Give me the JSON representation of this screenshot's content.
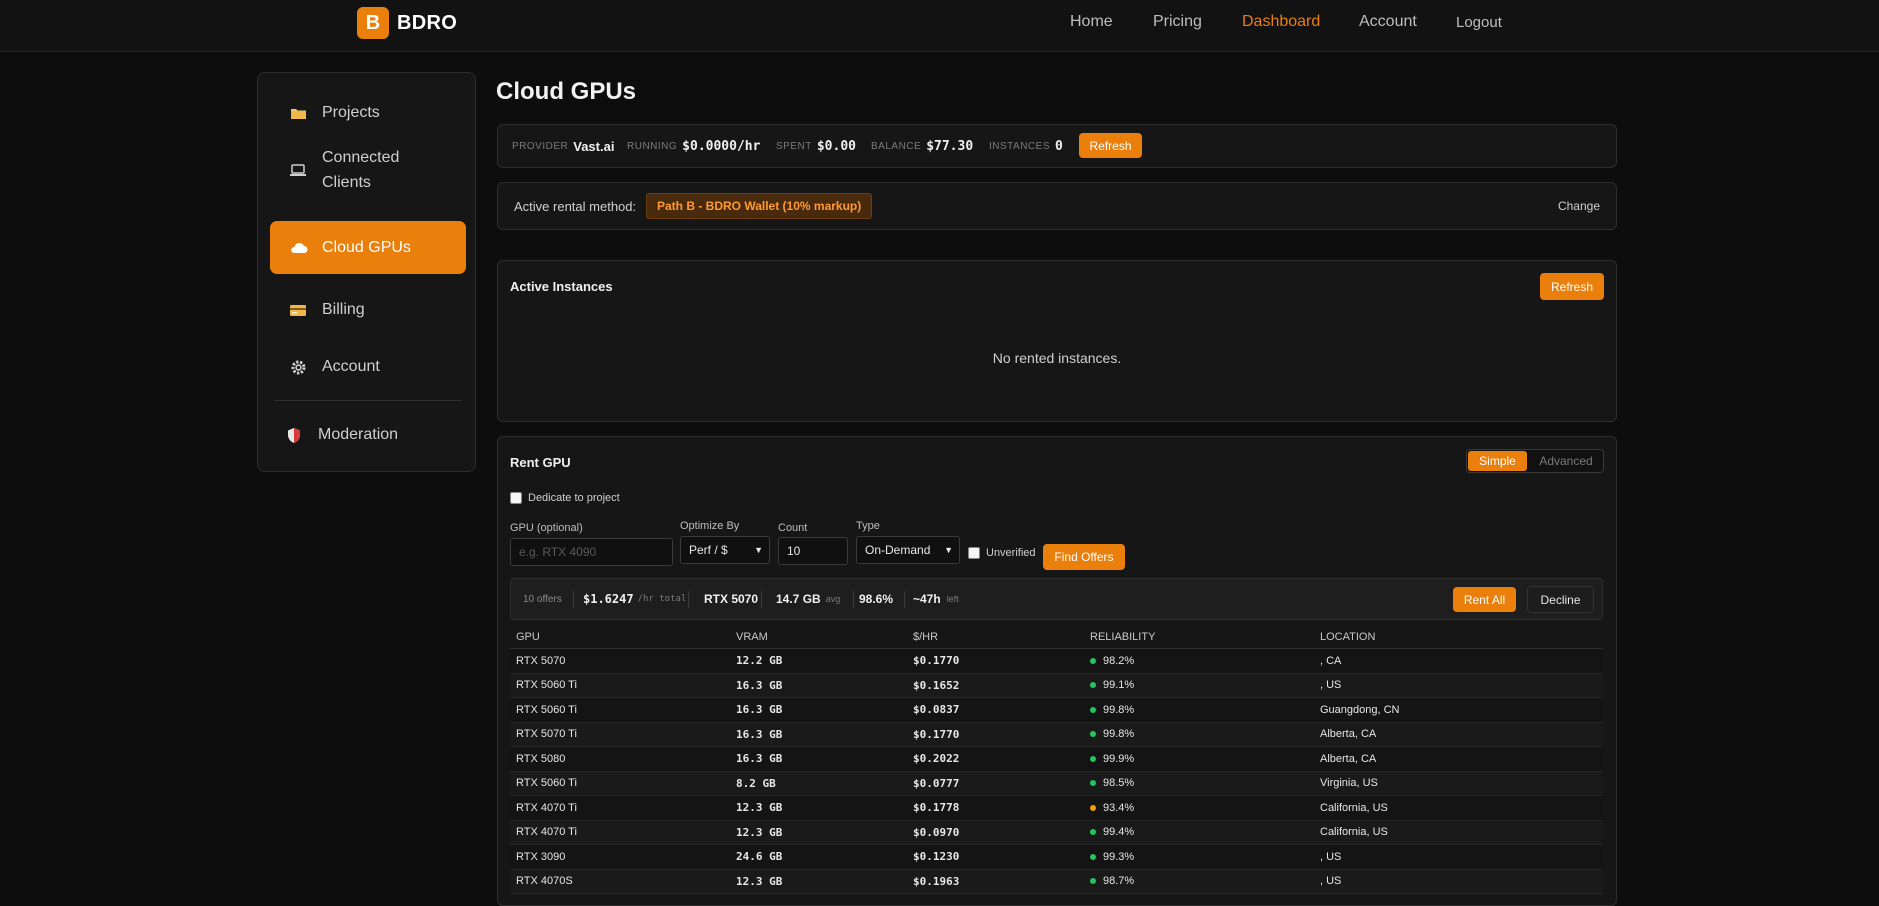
{
  "brand": {
    "logo_letter": "B",
    "name": "BDRO",
    "accent": "#ea7f0c"
  },
  "nav": {
    "home": "Home",
    "pricing": "Pricing",
    "dashboard": "Dashboard",
    "account": "Account",
    "logout": "Logout"
  },
  "sidebar": {
    "items": [
      {
        "label": "Projects",
        "icon": "folder-icon"
      },
      {
        "label": "Connected Clients",
        "icon": "laptop-icon"
      },
      {
        "label": "Cloud GPUs",
        "icon": "cloud-icon",
        "active": true
      },
      {
        "label": "Billing",
        "icon": "credit-card-icon"
      },
      {
        "label": "Account",
        "icon": "gear-icon"
      },
      {
        "label": "Moderation",
        "icon": "shield-icon"
      }
    ]
  },
  "page": {
    "title": "Cloud GPUs"
  },
  "stats": {
    "provider_label": "PROVIDER",
    "provider": "Vast.ai",
    "running_label": "RUNNING",
    "running": "$0.0000/hr",
    "spent_label": "SPENT",
    "spent": "$0.00",
    "balance_label": "BALANCE",
    "balance": "$77.30",
    "instances_label": "INSTANCES",
    "instances": "0",
    "refresh": "Refresh"
  },
  "rental": {
    "label": "Active rental method:",
    "method": "Path B - BDRO Wallet (10% markup)",
    "change": "Change"
  },
  "active_instances": {
    "title": "Active Instances",
    "refresh": "Refresh",
    "empty": "No rented instances."
  },
  "rent": {
    "title": "Rent GPU",
    "mode_simple": "Simple",
    "mode_advanced": "Advanced",
    "dedicate_label": "Dedicate to project",
    "gpu_label": "GPU (optional)",
    "gpu_placeholder": "e.g. RTX 4090",
    "optimize_label": "Optimize By",
    "optimize_value": "Perf / $",
    "count_label": "Count",
    "count_value": "10",
    "type_label": "Type",
    "type_value": "On-Demand",
    "unverified_label": "Unverified",
    "find_offers": "Find Offers"
  },
  "summary": {
    "offers": "10 offers",
    "total": "$1.6247",
    "total_unit": "/hr total",
    "gpu": "RTX 5070",
    "vram": "14.7 GB",
    "vram_unit": "avg",
    "reliability": "98.6%",
    "time": "~47h",
    "time_unit": "left",
    "rent_all": "Rent All",
    "decline": "Decline"
  },
  "table": {
    "headers": [
      "GPU",
      "VRAM",
      "$/HR",
      "RELIABILITY",
      "LOCATION"
    ],
    "rows": [
      {
        "gpu": "RTX 5070",
        "vram": "12.2 GB",
        "price": "$0.1770",
        "reliability": "98.2%",
        "status": "green",
        "location": ", CA"
      },
      {
        "gpu": "RTX 5060 Ti",
        "vram": "16.3 GB",
        "price": "$0.1652",
        "reliability": "99.1%",
        "status": "green",
        "location": ", US"
      },
      {
        "gpu": "RTX 5060 Ti",
        "vram": "16.3 GB",
        "price": "$0.0837",
        "reliability": "99.8%",
        "status": "green",
        "location": "Guangdong, CN"
      },
      {
        "gpu": "RTX 5070 Ti",
        "vram": "16.3 GB",
        "price": "$0.1770",
        "reliability": "99.8%",
        "status": "green",
        "location": "Alberta, CA"
      },
      {
        "gpu": "RTX 5080",
        "vram": "16.3 GB",
        "price": "$0.2022",
        "reliability": "99.9%",
        "status": "green",
        "location": "Alberta, CA"
      },
      {
        "gpu": "RTX 5060 Ti",
        "vram": "8.2 GB",
        "price": "$0.0777",
        "reliability": "98.5%",
        "status": "green",
        "location": "Virginia, US"
      },
      {
        "gpu": "RTX 4070 Ti",
        "vram": "12.3 GB",
        "price": "$0.1778",
        "reliability": "93.4%",
        "status": "orange",
        "location": "California, US"
      },
      {
        "gpu": "RTX 4070 Ti",
        "vram": "12.3 GB",
        "price": "$0.0970",
        "reliability": "99.4%",
        "status": "green",
        "location": "California, US"
      },
      {
        "gpu": "RTX 3090",
        "vram": "24.6 GB",
        "price": "$0.1230",
        "reliability": "99.3%",
        "status": "green",
        "location": ", US"
      },
      {
        "gpu": "RTX 4070S",
        "vram": "12.3 GB",
        "price": "$0.1963",
        "reliability": "98.7%",
        "status": "green",
        "location": ", US"
      }
    ],
    "status_colors": {
      "green": "#22c55e",
      "orange": "#f59e0b"
    }
  }
}
